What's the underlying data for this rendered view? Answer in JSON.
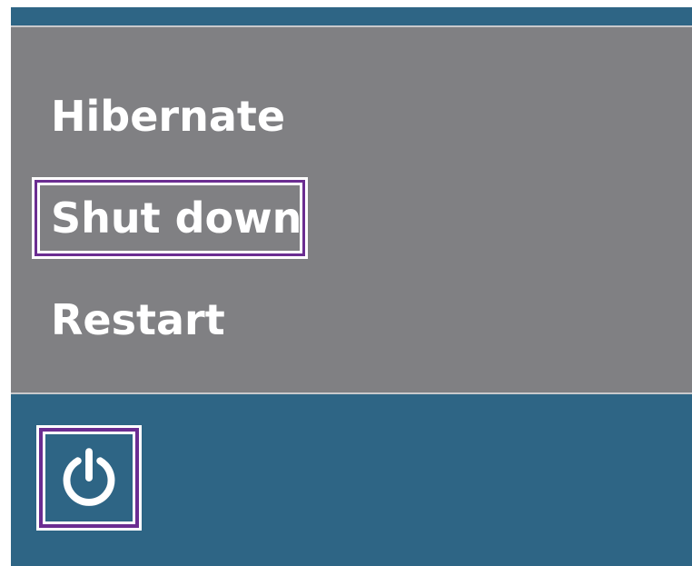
{
  "power_menu": {
    "items": [
      {
        "label": "Hibernate",
        "focused": false
      },
      {
        "label": "Shut down",
        "focused": true
      },
      {
        "label": "Restart",
        "focused": false
      }
    ]
  },
  "power_button": {
    "icon": "power-icon",
    "focused": true
  },
  "colors": {
    "taskbar": "#2e6585",
    "menu_background": "#808083",
    "focus_ring": "#6b2d91",
    "text": "#ffffff"
  }
}
